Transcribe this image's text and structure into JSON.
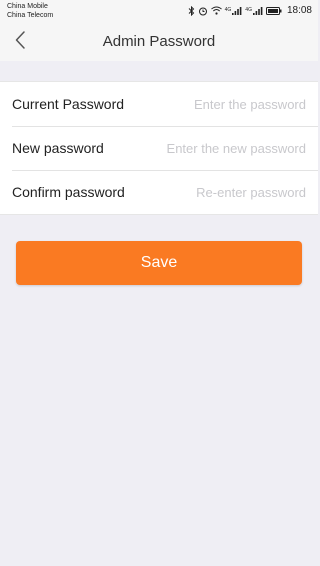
{
  "status_bar": {
    "carrier_1": "China Mobile",
    "carrier_2": "China Telecom",
    "network_1": "4G",
    "network_2": "4G",
    "time": "18:08"
  },
  "nav": {
    "title": "Admin Password",
    "back_icon": "chevron-left-icon"
  },
  "form": {
    "fields": [
      {
        "label": "Current Password",
        "placeholder": "Enter the password",
        "value": ""
      },
      {
        "label": "New password",
        "placeholder": "Enter the new password",
        "value": ""
      },
      {
        "label": "Confirm password",
        "placeholder": "Re-enter password",
        "value": ""
      }
    ]
  },
  "save_button": {
    "label": "Save",
    "color": "#fa7a22"
  },
  "colors": {
    "background": "#efeef4",
    "bar": "#f6f6f6",
    "accent": "#fa7a22"
  }
}
